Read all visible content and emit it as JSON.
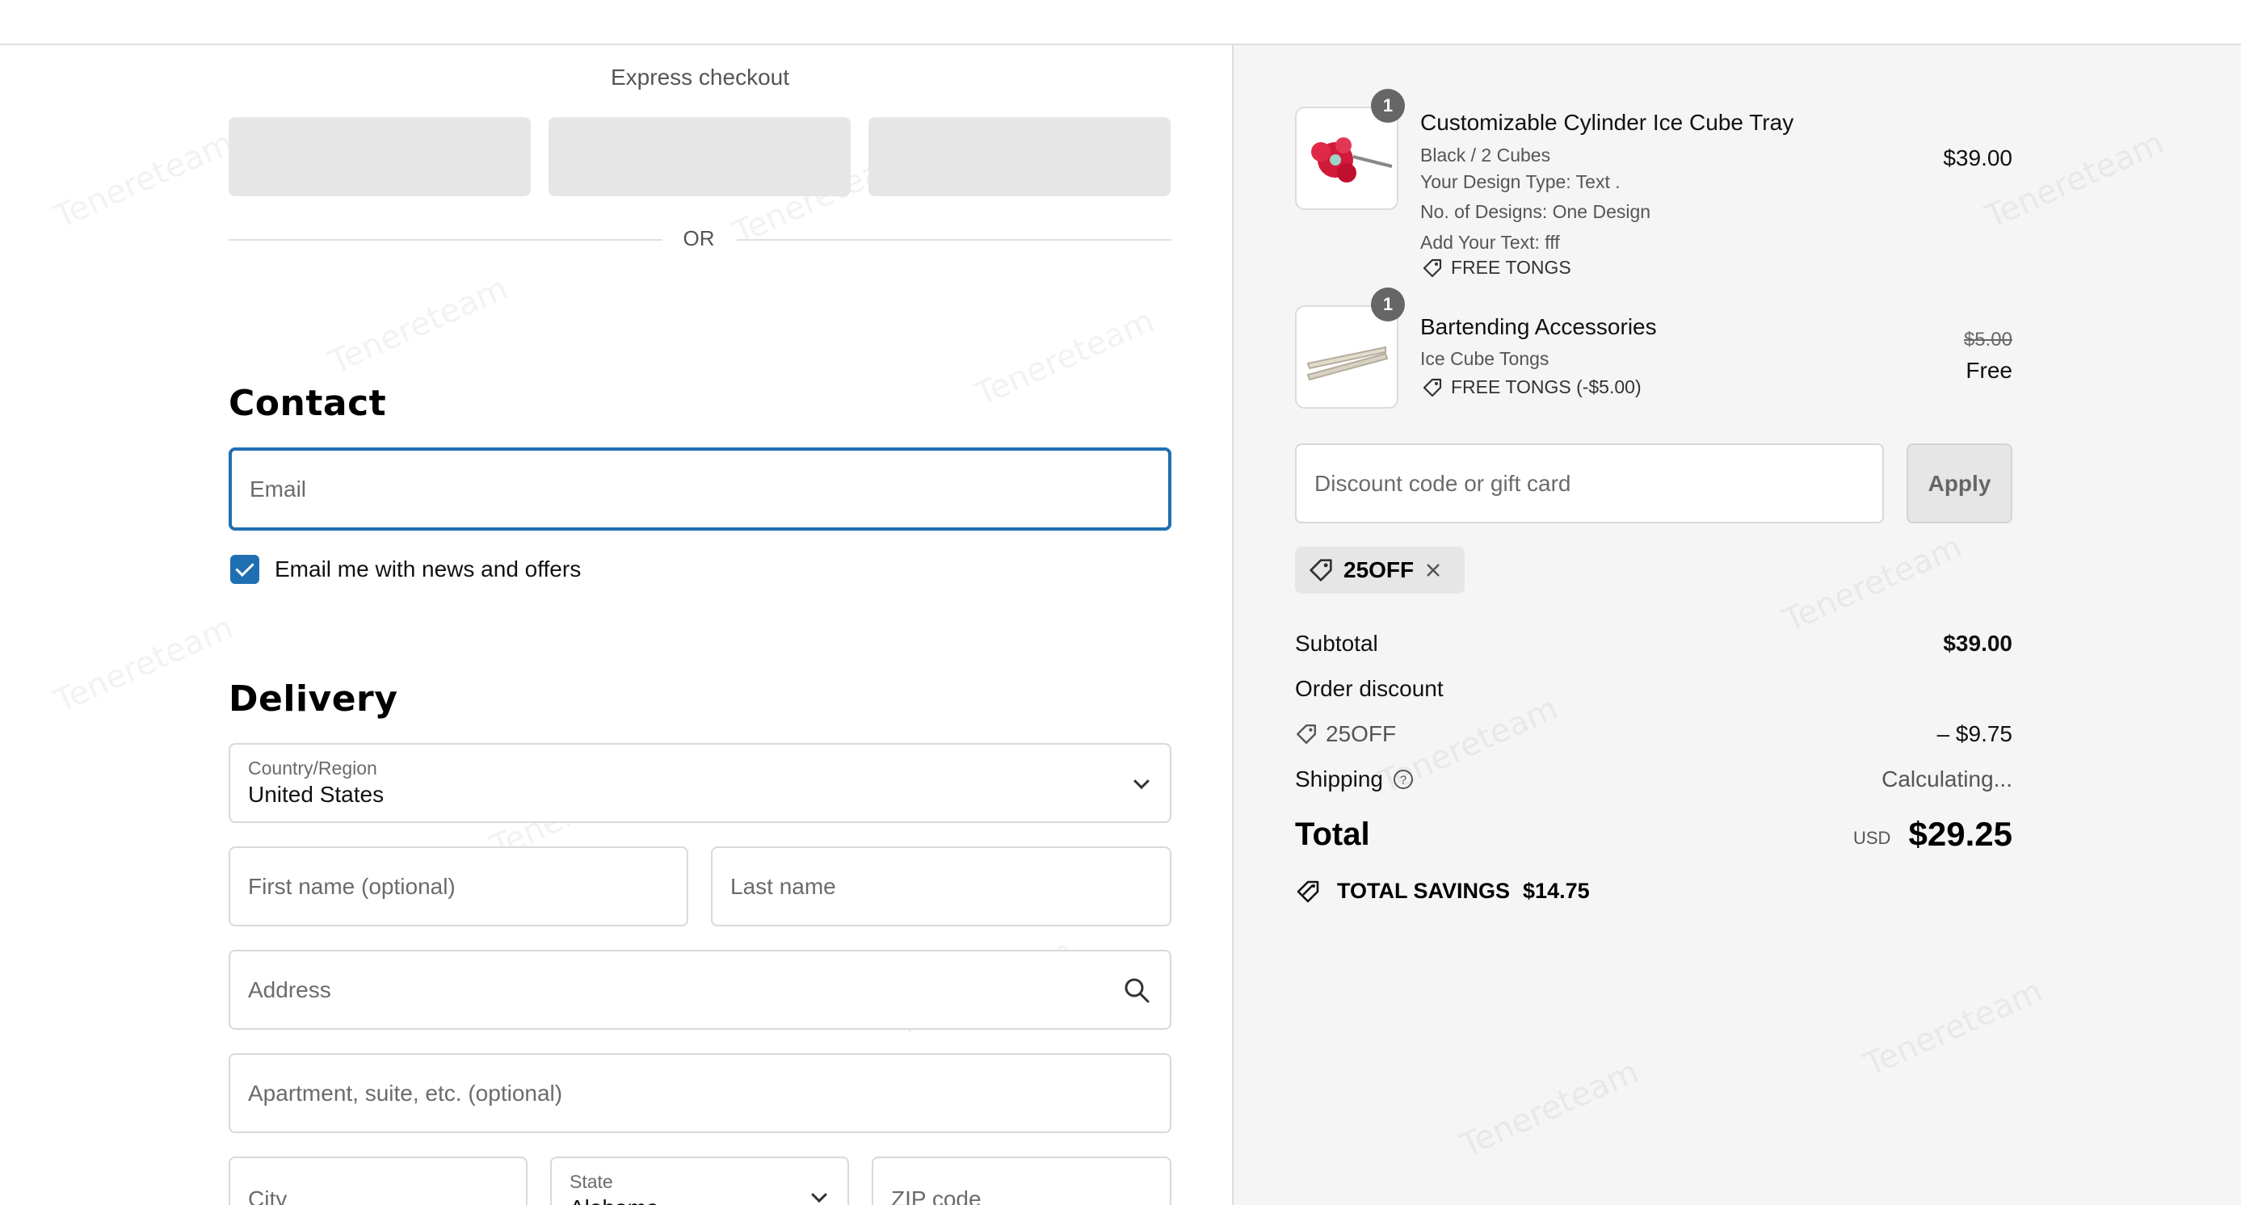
{
  "express": {
    "title": "Express checkout",
    "or_label": "OR"
  },
  "contact": {
    "title": "Contact",
    "email_placeholder": "Email",
    "newsletter_label": "Email me with news and offers",
    "newsletter_checked": true
  },
  "delivery": {
    "title": "Delivery",
    "country_label": "Country/Region",
    "country_value": "United States",
    "first_name_placeholder": "First name (optional)",
    "last_name_placeholder": "Last name",
    "address_placeholder": "Address",
    "apartment_placeholder": "Apartment, suite, etc. (optional)",
    "city_placeholder": "City",
    "state_label": "State",
    "state_value": "Alabama",
    "zip_placeholder": "ZIP code"
  },
  "cart": {
    "items": [
      {
        "qty": "1",
        "name": "Customizable Cylinder Ice Cube Tray",
        "variant": "Black / 2 Cubes",
        "details": [
          "Your Design Type: Text .",
          "No. of Designs: One Design",
          "Add Your Text: fff"
        ],
        "tag": "FREE TONGS",
        "price": "$39.00"
      },
      {
        "qty": "1",
        "name": "Bartending Accessories",
        "variant": "Ice Cube Tongs",
        "tag": "FREE TONGS (-$5.00)",
        "original_price": "$5.00",
        "price": "Free"
      }
    ],
    "discount_placeholder": "Discount code or gift card",
    "apply_label": "Apply",
    "applied_code": "25OFF"
  },
  "summary": {
    "subtotal_label": "Subtotal",
    "subtotal_value": "$39.00",
    "order_discount_label": "Order discount",
    "discount_code": "25OFF",
    "discount_value": "– $9.75",
    "shipping_label": "Shipping",
    "shipping_value": "Calculating...",
    "total_label": "Total",
    "currency": "USD",
    "total_value": "$29.25",
    "savings_label": "TOTAL SAVINGS",
    "savings_value": "$14.75"
  },
  "colors": {
    "accent": "#1f6fb2",
    "summary_bg": "#f5f5f5"
  }
}
